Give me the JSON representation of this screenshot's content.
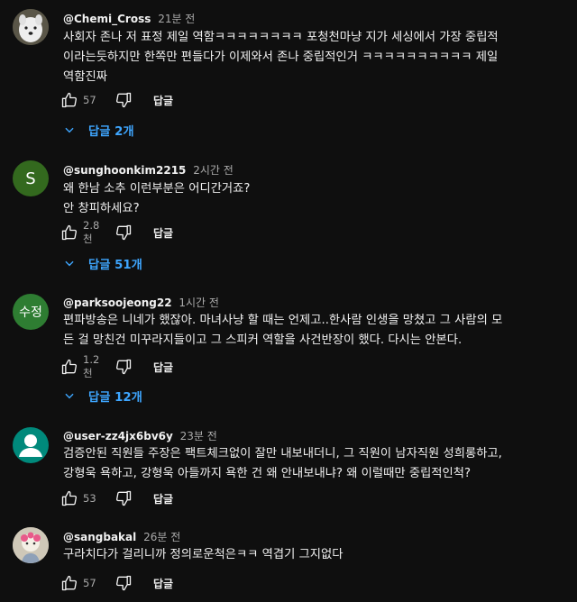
{
  "comments": [
    {
      "handle": "@Chemi_Cross",
      "time": "21분 전",
      "lines": [
        "사회자 존나 저 표정 제일 역함ㅋㅋㅋㅋㅋㅋㅋㅋ 포청천마냥 지가 세싱에서 가장 중립적",
        "이라는듯하지만 한쪽만 편들다가 이제와서 존나 중립적인거 ㅋㅋㅋㅋㅋㅋㅋㅋㅋㅋ 제일",
        "역함진짜"
      ],
      "likes": "57",
      "reply_label": "답글",
      "replies": "답글 2개",
      "avatar_icon": "dog-photo-icon"
    },
    {
      "handle": "@sunghoonkim2215",
      "time": "2시간 전",
      "lines": [
        "왜 한남 소추 이런부분은 어디간거죠?",
        "안 창피하세요?"
      ],
      "likes": "2.8천",
      "reply_label": "답글",
      "replies": "답글 51개",
      "avatar_letter": "S",
      "avatar_color": "#33691e"
    },
    {
      "handle": "@parksoojeong22",
      "time": "1시간 전",
      "lines": [
        "편파방송은 니네가 했잖아. 마녀사냥 할 때는 언제고..한사람 인생을 망쳤고 그 사람의 모",
        "든 걸 망친건 미꾸라지들이고 그 스피커 역할을 사건반장이 했다. 다시는 안본다."
      ],
      "likes": "1.2천",
      "reply_label": "답글",
      "replies": "답글 12개",
      "avatar_letter": "수정",
      "avatar_color": "#2e7d32"
    },
    {
      "handle": "@user-zz4jx6bv6y",
      "time": "23분 전",
      "lines": [
        "검증안된 직원들 주장은 팩트체크없이 잘만 내보내더니, 그 직원이 남자직원 성희롱하고,",
        "강형욱 욕하고, 강형욱 아들까지 욕한 건 왜 안내보내냐? 왜 이럴때만 중립적인척?"
      ],
      "likes": "53",
      "reply_label": "답글",
      "avatar_icon": "default-user-icon",
      "avatar_color": "#00897b"
    },
    {
      "handle": "@sangbakal",
      "time": "26분 전",
      "lines": [
        "구라치다가 걸리니까 정의로운척은ㅋㅋ 역겹기 그지없다"
      ],
      "likes": "57",
      "reply_label": "답글",
      "avatar_icon": "character-photo-icon"
    }
  ]
}
